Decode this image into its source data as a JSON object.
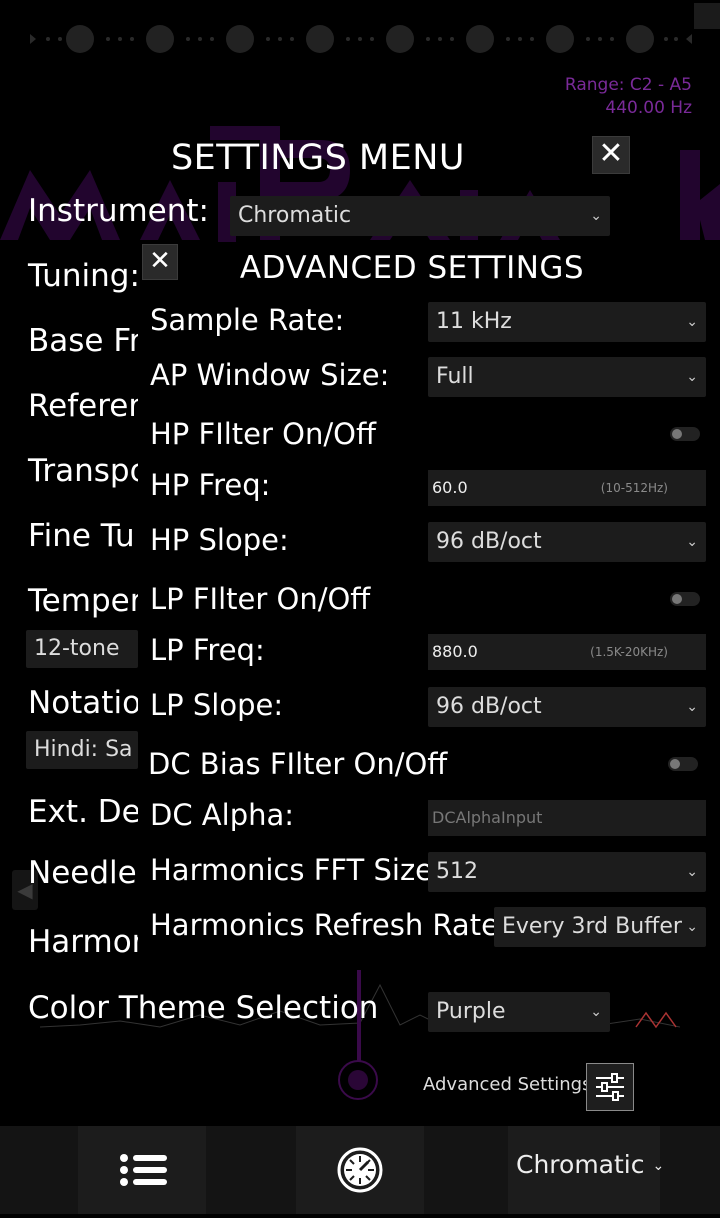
{
  "header": {
    "range_text": "Range: C2 - A5",
    "freq_text": "440.00 Hz"
  },
  "settings_menu": {
    "title": "SETTINGS MENU",
    "close_glyph": "✕",
    "labels": {
      "instrument": "Instrument:",
      "tuning": "Tuning:",
      "base_freq": "Base Fr",
      "reference": "Referer",
      "transpose": "Transpo",
      "fine_tune": "Fine Tu",
      "temperament": "Temper",
      "notation": "Notatio",
      "ext_detect": "Ext. Det",
      "needle": "Needle",
      "harmonics": "Harmon",
      "color_theme": "Color Theme Selection"
    },
    "instrument_value": "Chromatic",
    "temperament_value": "12-tone",
    "notation_value": "Hindi: Sa R",
    "color_theme_value": "Purple",
    "advanced_link": "Advanced Settings"
  },
  "advanced": {
    "title": "ADVANCED SETTINGS",
    "close_glyph": "✕",
    "sample_rate": {
      "label": "Sample Rate:",
      "value": "11 kHz"
    },
    "ap_window": {
      "label": "AP Window Size:",
      "value": "Full"
    },
    "hp_filter": {
      "label": "HP FIlter On/Off"
    },
    "hp_freq": {
      "label": "HP Freq:",
      "value": "60.0",
      "hint": "(10-512Hz)"
    },
    "hp_slope": {
      "label": "HP Slope:",
      "value": "96 dB/oct"
    },
    "lp_filter": {
      "label": "LP FIlter On/Off"
    },
    "lp_freq": {
      "label": "LP Freq:",
      "value": "880.0",
      "hint": "(1.5K-20KHz)"
    },
    "lp_slope": {
      "label": "LP Slope:",
      "value": "96 dB/oct"
    },
    "dc_bias": {
      "label": "DC Bias FIlter On/Off"
    },
    "dc_alpha": {
      "label": "DC Alpha:",
      "placeholder": "DCAlphaInput"
    },
    "fft_size": {
      "label": "Harmonics FFT Size:",
      "value": "512"
    },
    "refresh_rate": {
      "label": "Harmonics Refresh Rate:",
      "value": "Every 3rd Buffer"
    }
  },
  "bottom_bar": {
    "instrument_label": "Chromatic"
  },
  "colors": {
    "accent": "#7a2a99",
    "background": "#000000",
    "control_bg": "#1c1c1c"
  },
  "icons": {
    "menu": "list-icon",
    "tuner": "dial-icon",
    "advanced": "sliders-icon",
    "close": "close-icon",
    "chevron": "chevron-down-icon"
  }
}
